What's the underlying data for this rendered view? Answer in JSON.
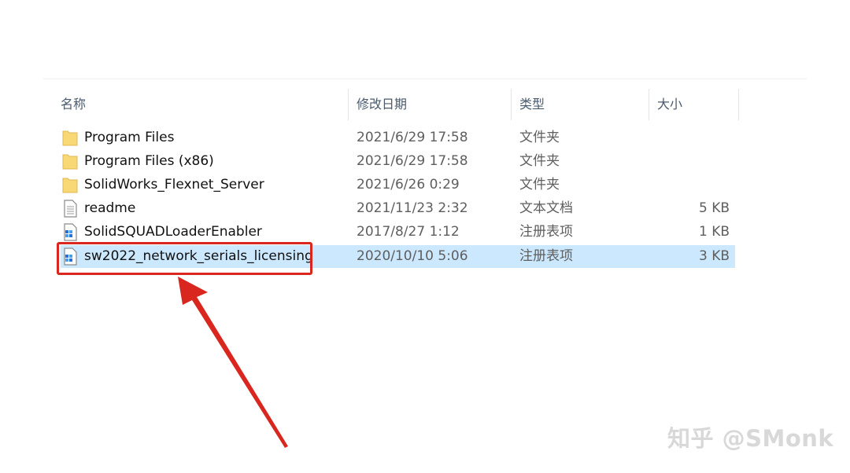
{
  "columns": {
    "name": "名称",
    "date": "修改日期",
    "type": "类型",
    "size": "大小"
  },
  "files": [
    {
      "name": "Program Files",
      "date": "2021/6/29 17:58",
      "type": "文件夹",
      "size": "",
      "icon": "folder-icon"
    },
    {
      "name": "Program Files (x86)",
      "date": "2021/6/29 17:58",
      "type": "文件夹",
      "size": "",
      "icon": "folder-icon"
    },
    {
      "name": "SolidWorks_Flexnet_Server",
      "date": "2021/6/26 0:29",
      "type": "文件夹",
      "size": "",
      "icon": "folder-icon"
    },
    {
      "name": "readme",
      "date": "2021/11/23 2:32",
      "type": "文本文档",
      "size": "5 KB",
      "icon": "text-document-icon"
    },
    {
      "name": "SolidSQUADLoaderEnabler",
      "date": "2017/8/27 1:12",
      "type": "注册表项",
      "size": "1 KB",
      "icon": "registry-file-icon"
    },
    {
      "name": "sw2022_network_serials_licensing",
      "date": "2020/10/10 5:06",
      "type": "注册表项",
      "size": "3 KB",
      "icon": "registry-file-icon",
      "selected": true
    }
  ],
  "watermark": "知乎 @SMonk",
  "colors": {
    "selection": "#cce8ff",
    "annotation": "#d9271f",
    "folder": "#f8d775"
  }
}
